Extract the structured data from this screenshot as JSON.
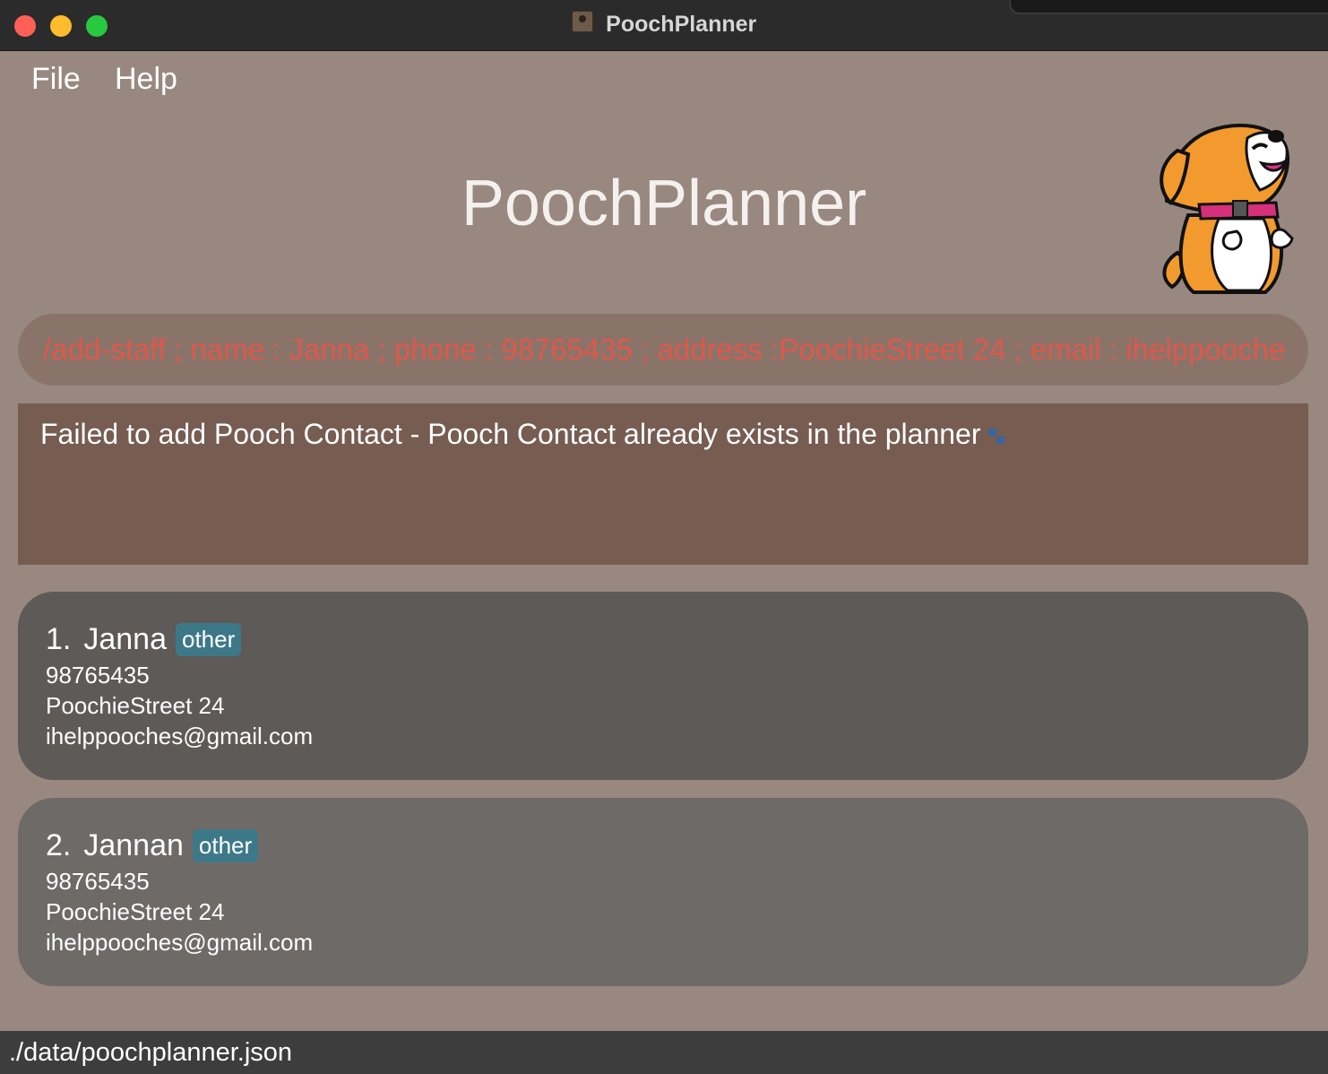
{
  "window": {
    "title": "PoochPlanner"
  },
  "menu": {
    "file": "File",
    "help": "Help"
  },
  "header": {
    "title": "PoochPlanner"
  },
  "command": {
    "value": "/add-staff ; name : Janna ; phone : 98765435 ; address :PoochieStreet 24 ; email : ihelppooches@gmail.com",
    "text_color": "#e0574a"
  },
  "result": {
    "message": "Failed to add Pooch Contact - Pooch Contact already exists in the planner",
    "icon": "paw-icon"
  },
  "contacts": [
    {
      "index": "1.",
      "name": "Janna",
      "tag": "other",
      "phone": "98765435",
      "address": "PoochieStreet 24",
      "email": "ihelppooches@gmail.com"
    },
    {
      "index": "2.",
      "name": "Jannan",
      "tag": "other",
      "phone": "98765435",
      "address": "PoochieStreet 24",
      "email": "ihelppooches@gmail.com"
    }
  ],
  "status": {
    "path": "./data/poochplanner.json"
  },
  "colors": {
    "background": "#988880",
    "command_box": "#8a7469",
    "result_box": "#765c51",
    "card_selected": "#5e5a57",
    "card": "#6e6a68",
    "tag": "#3d7888",
    "status_bar": "#3d3d3d"
  }
}
